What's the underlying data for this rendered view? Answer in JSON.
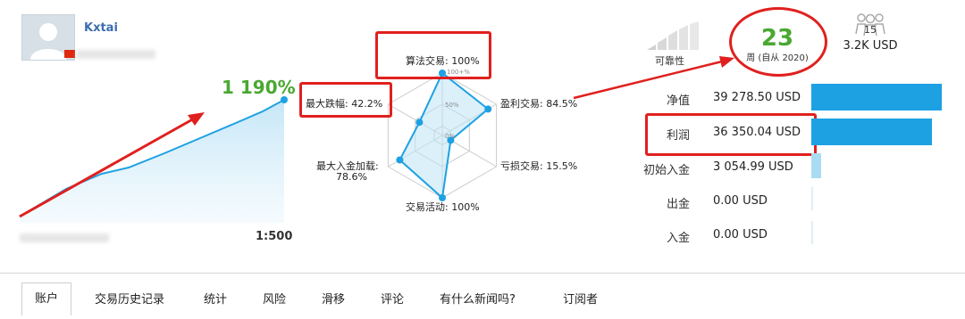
{
  "user": {
    "name": "Kxtai",
    "flag_color": "#de2910"
  },
  "growth": {
    "gain": "1 190%",
    "leverage": "1:500",
    "gain_color": "#4aa832",
    "line_color": "#1da1e3"
  },
  "radar": {
    "labels": {
      "algo": "算法交易: 100%",
      "drawdown": "最大跌幅: 42.2%",
      "profit": "盈利交易: 84.5%",
      "loss": "亏损交易: 15.5%",
      "deposit_load_title": "最大入金加载:",
      "deposit_load_value": "78.6%",
      "activity": "交易活动: 100%"
    },
    "rings": {
      "outer": "100+%",
      "mid": "50%",
      "inner": "0%"
    },
    "values": {
      "algo": 1.0,
      "profit": 0.845,
      "loss": 0.155,
      "activity": 1.0,
      "deposit_load": 0.786,
      "drawdown": 0.422
    }
  },
  "reliability": {
    "label": "可靠性"
  },
  "weeks": {
    "value": "23",
    "label": "周 (自从 2020)"
  },
  "subscribers": {
    "count": "15",
    "funds": "3.2K USD"
  },
  "stats": [
    {
      "label": "净值",
      "value": "39 278.50 USD",
      "bar_fraction": 1.0,
      "bar_style": "dark"
    },
    {
      "label": "利润",
      "value": "36 350.04 USD",
      "bar_fraction": 0.925,
      "bar_style": "dark"
    },
    {
      "label": "初始入金",
      "value": "3 054.99 USD",
      "bar_fraction": 0.078,
      "bar_style": "light"
    },
    {
      "label": "出金",
      "value": "0.00 USD",
      "bar_fraction": 0.0,
      "bar_style": "thin"
    },
    {
      "label": "入金",
      "value": "0.00 USD",
      "bar_fraction": 0.0,
      "bar_style": "thin"
    }
  ],
  "tabs": [
    {
      "label": "账户",
      "active": true
    },
    {
      "label": "交易历史记录"
    },
    {
      "label": "统计"
    },
    {
      "label": "风险"
    },
    {
      "label": "滑移"
    },
    {
      "label": "评论"
    },
    {
      "label": "有什么新闻吗?"
    },
    {
      "label": "订阅者"
    }
  ],
  "colors": {
    "accent_blue": "#1da1e3",
    "highlight_red": "#e0201e",
    "green": "#4aa832"
  }
}
